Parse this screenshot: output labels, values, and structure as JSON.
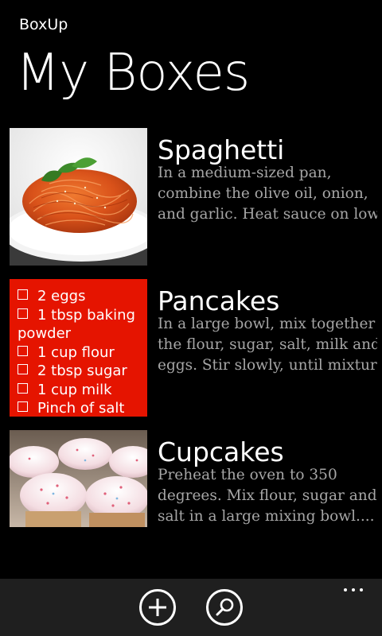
{
  "app": {
    "name": "BoxUp",
    "page_title": "My Boxes"
  },
  "boxes": [
    {
      "title": "Spaghetti",
      "description_lines": [
        "In a medium-sized pan,",
        "combine the olive oil, onion,",
        "and garlic. Heat sauce on low..."
      ],
      "thumb_type": "photo-spaghetti"
    },
    {
      "title": "Pancakes",
      "description_lines": [
        "In a large bowl, mix together",
        "the flour, sugar, salt, milk and",
        "eggs. Stir slowly, until mixture..."
      ],
      "thumb_type": "ingredient-list",
      "ingredients": [
        "2 eggs",
        "1 tbsp baking",
        "powder",
        "1 cup flour",
        "2 tbsp sugar",
        "1 cup milk",
        "Pinch of salt"
      ]
    },
    {
      "title": "Cupcakes",
      "description_lines": [
        "Preheat the oven to 350",
        "degrees. Mix flour, sugar and",
        "salt in a large mixing bowl...."
      ],
      "thumb_type": "photo-cupcakes"
    }
  ],
  "app_bar": {
    "buttons": [
      {
        "icon": "add-icon"
      },
      {
        "icon": "search-icon"
      }
    ],
    "more_icon": "ellipsis-icon"
  },
  "colors": {
    "background": "#000000",
    "accent_red": "#e51400",
    "subtle_text": "#a6a6a6",
    "app_bar": "#1f1f1f"
  }
}
